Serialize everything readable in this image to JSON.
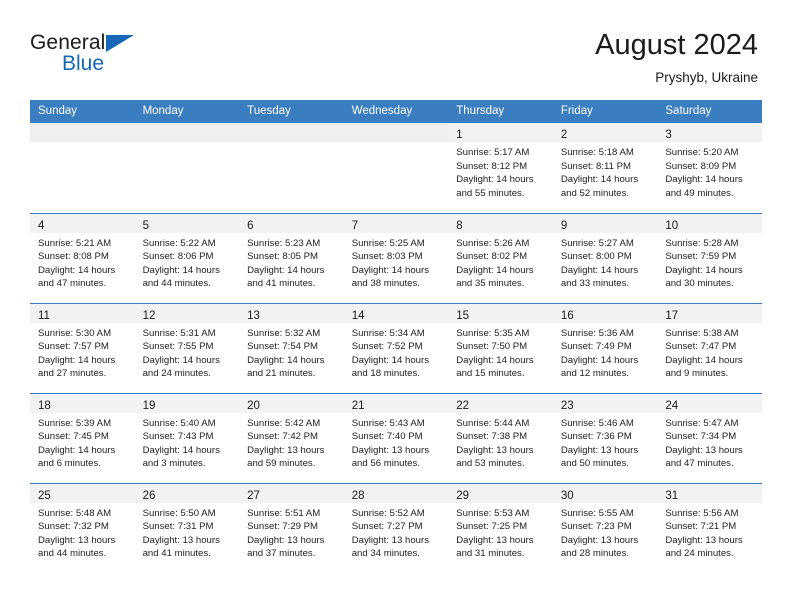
{
  "brand": {
    "name_top": "General",
    "name_bottom": "Blue",
    "triangle_color": "#1667b8"
  },
  "header": {
    "title": "August 2024",
    "subtitle": "Pryshyb, Ukraine"
  },
  "theme": {
    "header_blue": "#3b7dc1",
    "band_gray": "#f2f2f2",
    "text_dark": "#1b1b1b"
  },
  "weekday_headers": [
    "Sunday",
    "Monday",
    "Tuesday",
    "Wednesday",
    "Thursday",
    "Friday",
    "Saturday"
  ],
  "labels": {
    "sunrise_prefix": "Sunrise:",
    "sunset_prefix": "Sunset:",
    "daylight_prefix": "Daylight:"
  },
  "weeks": [
    [
      {
        "day": "",
        "empty": true
      },
      {
        "day": "",
        "empty": true
      },
      {
        "day": "",
        "empty": true
      },
      {
        "day": "",
        "empty": true
      },
      {
        "day": "1",
        "sunrise": "Sunrise: 5:17 AM",
        "sunset": "Sunset: 8:12 PM",
        "daylight_1": "Daylight: 14 hours",
        "daylight_2": "and 55 minutes."
      },
      {
        "day": "2",
        "sunrise": "Sunrise: 5:18 AM",
        "sunset": "Sunset: 8:11 PM",
        "daylight_1": "Daylight: 14 hours",
        "daylight_2": "and 52 minutes."
      },
      {
        "day": "3",
        "sunrise": "Sunrise: 5:20 AM",
        "sunset": "Sunset: 8:09 PM",
        "daylight_1": "Daylight: 14 hours",
        "daylight_2": "and 49 minutes."
      }
    ],
    [
      {
        "day": "4",
        "sunrise": "Sunrise: 5:21 AM",
        "sunset": "Sunset: 8:08 PM",
        "daylight_1": "Daylight: 14 hours",
        "daylight_2": "and 47 minutes."
      },
      {
        "day": "5",
        "sunrise": "Sunrise: 5:22 AM",
        "sunset": "Sunset: 8:06 PM",
        "daylight_1": "Daylight: 14 hours",
        "daylight_2": "and 44 minutes."
      },
      {
        "day": "6",
        "sunrise": "Sunrise: 5:23 AM",
        "sunset": "Sunset: 8:05 PM",
        "daylight_1": "Daylight: 14 hours",
        "daylight_2": "and 41 minutes."
      },
      {
        "day": "7",
        "sunrise": "Sunrise: 5:25 AM",
        "sunset": "Sunset: 8:03 PM",
        "daylight_1": "Daylight: 14 hours",
        "daylight_2": "and 38 minutes."
      },
      {
        "day": "8",
        "sunrise": "Sunrise: 5:26 AM",
        "sunset": "Sunset: 8:02 PM",
        "daylight_1": "Daylight: 14 hours",
        "daylight_2": "and 35 minutes."
      },
      {
        "day": "9",
        "sunrise": "Sunrise: 5:27 AM",
        "sunset": "Sunset: 8:00 PM",
        "daylight_1": "Daylight: 14 hours",
        "daylight_2": "and 33 minutes."
      },
      {
        "day": "10",
        "sunrise": "Sunrise: 5:28 AM",
        "sunset": "Sunset: 7:59 PM",
        "daylight_1": "Daylight: 14 hours",
        "daylight_2": "and 30 minutes."
      }
    ],
    [
      {
        "day": "11",
        "sunrise": "Sunrise: 5:30 AM",
        "sunset": "Sunset: 7:57 PM",
        "daylight_1": "Daylight: 14 hours",
        "daylight_2": "and 27 minutes."
      },
      {
        "day": "12",
        "sunrise": "Sunrise: 5:31 AM",
        "sunset": "Sunset: 7:55 PM",
        "daylight_1": "Daylight: 14 hours",
        "daylight_2": "and 24 minutes."
      },
      {
        "day": "13",
        "sunrise": "Sunrise: 5:32 AM",
        "sunset": "Sunset: 7:54 PM",
        "daylight_1": "Daylight: 14 hours",
        "daylight_2": "and 21 minutes."
      },
      {
        "day": "14",
        "sunrise": "Sunrise: 5:34 AM",
        "sunset": "Sunset: 7:52 PM",
        "daylight_1": "Daylight: 14 hours",
        "daylight_2": "and 18 minutes."
      },
      {
        "day": "15",
        "sunrise": "Sunrise: 5:35 AM",
        "sunset": "Sunset: 7:50 PM",
        "daylight_1": "Daylight: 14 hours",
        "daylight_2": "and 15 minutes."
      },
      {
        "day": "16",
        "sunrise": "Sunrise: 5:36 AM",
        "sunset": "Sunset: 7:49 PM",
        "daylight_1": "Daylight: 14 hours",
        "daylight_2": "and 12 minutes."
      },
      {
        "day": "17",
        "sunrise": "Sunrise: 5:38 AM",
        "sunset": "Sunset: 7:47 PM",
        "daylight_1": "Daylight: 14 hours",
        "daylight_2": "and 9 minutes."
      }
    ],
    [
      {
        "day": "18",
        "sunrise": "Sunrise: 5:39 AM",
        "sunset": "Sunset: 7:45 PM",
        "daylight_1": "Daylight: 14 hours",
        "daylight_2": "and 6 minutes."
      },
      {
        "day": "19",
        "sunrise": "Sunrise: 5:40 AM",
        "sunset": "Sunset: 7:43 PM",
        "daylight_1": "Daylight: 14 hours",
        "daylight_2": "and 3 minutes."
      },
      {
        "day": "20",
        "sunrise": "Sunrise: 5:42 AM",
        "sunset": "Sunset: 7:42 PM",
        "daylight_1": "Daylight: 13 hours",
        "daylight_2": "and 59 minutes."
      },
      {
        "day": "21",
        "sunrise": "Sunrise: 5:43 AM",
        "sunset": "Sunset: 7:40 PM",
        "daylight_1": "Daylight: 13 hours",
        "daylight_2": "and 56 minutes."
      },
      {
        "day": "22",
        "sunrise": "Sunrise: 5:44 AM",
        "sunset": "Sunset: 7:38 PM",
        "daylight_1": "Daylight: 13 hours",
        "daylight_2": "and 53 minutes."
      },
      {
        "day": "23",
        "sunrise": "Sunrise: 5:46 AM",
        "sunset": "Sunset: 7:36 PM",
        "daylight_1": "Daylight: 13 hours",
        "daylight_2": "and 50 minutes."
      },
      {
        "day": "24",
        "sunrise": "Sunrise: 5:47 AM",
        "sunset": "Sunset: 7:34 PM",
        "daylight_1": "Daylight: 13 hours",
        "daylight_2": "and 47 minutes."
      }
    ],
    [
      {
        "day": "25",
        "sunrise": "Sunrise: 5:48 AM",
        "sunset": "Sunset: 7:32 PM",
        "daylight_1": "Daylight: 13 hours",
        "daylight_2": "and 44 minutes."
      },
      {
        "day": "26",
        "sunrise": "Sunrise: 5:50 AM",
        "sunset": "Sunset: 7:31 PM",
        "daylight_1": "Daylight: 13 hours",
        "daylight_2": "and 41 minutes."
      },
      {
        "day": "27",
        "sunrise": "Sunrise: 5:51 AM",
        "sunset": "Sunset: 7:29 PM",
        "daylight_1": "Daylight: 13 hours",
        "daylight_2": "and 37 minutes."
      },
      {
        "day": "28",
        "sunrise": "Sunrise: 5:52 AM",
        "sunset": "Sunset: 7:27 PM",
        "daylight_1": "Daylight: 13 hours",
        "daylight_2": "and 34 minutes."
      },
      {
        "day": "29",
        "sunrise": "Sunrise: 5:53 AM",
        "sunset": "Sunset: 7:25 PM",
        "daylight_1": "Daylight: 13 hours",
        "daylight_2": "and 31 minutes."
      },
      {
        "day": "30",
        "sunrise": "Sunrise: 5:55 AM",
        "sunset": "Sunset: 7:23 PM",
        "daylight_1": "Daylight: 13 hours",
        "daylight_2": "and 28 minutes."
      },
      {
        "day": "31",
        "sunrise": "Sunrise: 5:56 AM",
        "sunset": "Sunset: 7:21 PM",
        "daylight_1": "Daylight: 13 hours",
        "daylight_2": "and 24 minutes."
      }
    ]
  ]
}
